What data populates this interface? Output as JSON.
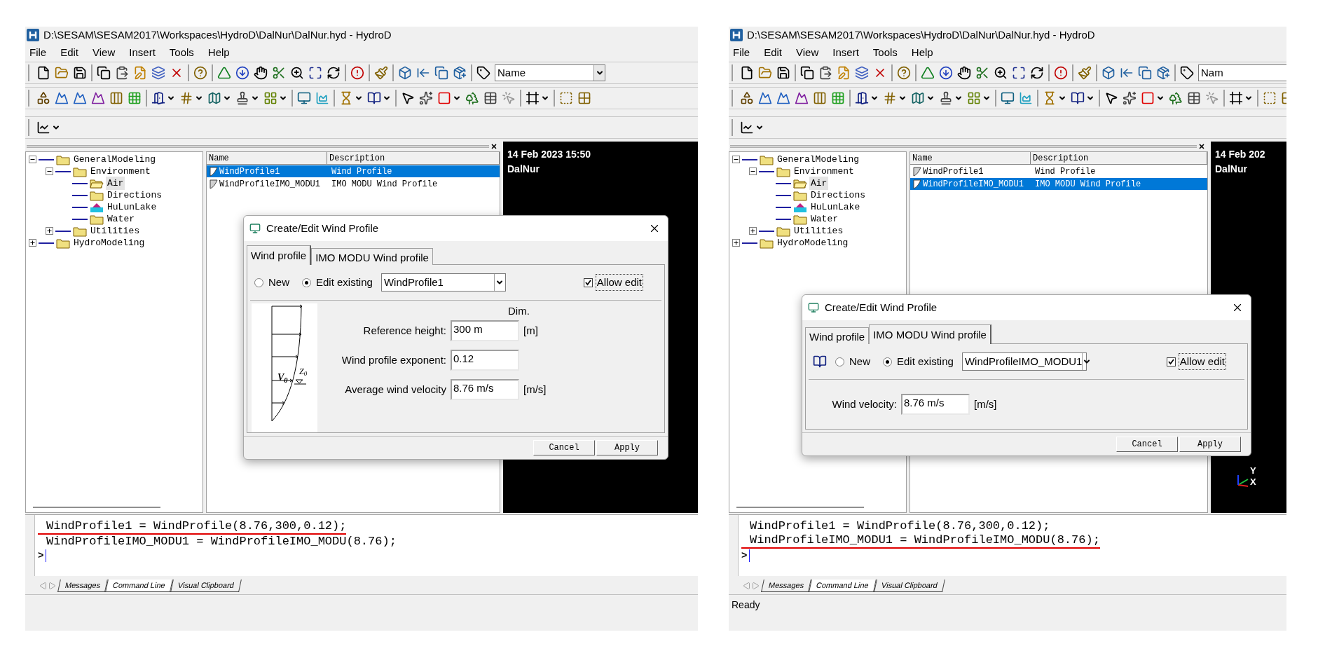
{
  "windows": [
    {
      "title": "D:\\SESAM\\SESAM2017\\Workspaces\\HydroD\\DalNur\\DalNur.hyd - HydroD",
      "menu": [
        "File",
        "Edit",
        "View",
        "Insert",
        "Tools",
        "Help"
      ],
      "toolbar_combo": "Name",
      "tree": [
        {
          "label": "GeneralModeling",
          "kind": "folder",
          "expanded": true,
          "selected": false,
          "children": [
            {
              "label": "Environment",
              "kind": "folder",
              "expanded": true,
              "selected": false,
              "children": [
                {
                  "label": "Air",
                  "kind": "open-folder",
                  "selected": true
                },
                {
                  "label": "Directions",
                  "kind": "folder",
                  "selected": false
                },
                {
                  "label": "HuLunLake",
                  "kind": "lake",
                  "selected": false
                },
                {
                  "label": "Water",
                  "kind": "folder",
                  "selected": false
                }
              ]
            },
            {
              "label": "Utilities",
              "kind": "folder",
              "expanded": false,
              "selected": false
            }
          ]
        },
        {
          "label": "HydroModeling",
          "kind": "folder",
          "expanded": false,
          "selected": false
        }
      ],
      "list": {
        "columns": [
          "Name",
          "Description"
        ],
        "rows": [
          {
            "name": "WindProfile1",
            "description": "Wind Profile",
            "selected": true
          },
          {
            "name": "WindProfileIMO_MODU1",
            "description": "IMO MODU Wind Profile",
            "selected": false
          }
        ]
      },
      "viewport": {
        "date": "14 Feb 2023 15:50",
        "name": "DalNur"
      },
      "dialog": {
        "kind": "wind_profile",
        "title": "Create/Edit Wind Profile",
        "tabs": [
          {
            "label": "Wind profile",
            "selected": true
          },
          {
            "label": "IMO MODU Wind profile",
            "selected": false
          }
        ],
        "modes": [
          {
            "label": "New",
            "selected": false
          },
          {
            "label": "Edit existing",
            "selected": true
          }
        ],
        "dropdown": "WindProfile1",
        "allow_edit": {
          "label": "Allow edit",
          "checked": true
        },
        "diagram_labels": [
          "V$_{0}$",
          "Z$_{0}$"
        ],
        "dim_heading": "Dim.",
        "fields": [
          {
            "label": "Reference height:",
            "value": "300 m",
            "unit": "[m]"
          },
          {
            "label": "Wind profile exponent:",
            "value": "0.12"
          },
          {
            "label": "Average wind velocity",
            "value": "8.76 m/s",
            "unit": "[m/s]"
          }
        ],
        "buttons": [
          "Cancel",
          "Apply"
        ]
      },
      "console": {
        "lines": [
          {
            "text": "WindProfile1 = WindProfile(8.76,300,0.12);",
            "underlined": true
          },
          {
            "text": "WindProfileIMO_MODU1 = WindProfileIMO_MODU(8.76);",
            "underlined": false
          }
        ],
        "prompt": ">",
        "tabs": [
          {
            "label": "Messages",
            "selected": false
          },
          {
            "label": "Command Line",
            "selected": true
          },
          {
            "label": "Visual Clipboard",
            "selected": false
          }
        ]
      }
    },
    {
      "title": "D:\\SESAM\\SESAM2017\\Workspaces\\HydroD\\DalNur\\DalNur.hyd - HydroD",
      "menu": [
        "File",
        "Edit",
        "View",
        "Insert",
        "Tools",
        "Help"
      ],
      "toolbar_combo": "Nam",
      "tree": [
        {
          "label": "GeneralModeling",
          "kind": "folder",
          "expanded": true,
          "selected": false,
          "children": [
            {
              "label": "Environment",
              "kind": "folder",
              "expanded": true,
              "selected": false,
              "children": [
                {
                  "label": "Air",
                  "kind": "open-folder",
                  "selected": true
                },
                {
                  "label": "Directions",
                  "kind": "folder",
                  "selected": false
                },
                {
                  "label": "HuLunLake",
                  "kind": "lake",
                  "selected": false
                },
                {
                  "label": "Water",
                  "kind": "folder",
                  "selected": false
                }
              ]
            },
            {
              "label": "Utilities",
              "kind": "folder",
              "expanded": false,
              "selected": false
            }
          ]
        },
        {
          "label": "HydroModeling",
          "kind": "folder",
          "expanded": false,
          "selected": false
        }
      ],
      "list": {
        "columns": [
          "Name",
          "Description"
        ],
        "rows": [
          {
            "name": "WindProfile1",
            "description": "Wind Profile",
            "selected": false
          },
          {
            "name": "WindProfileIMO_MODU1",
            "description": "IMO MODU Wind Profile",
            "selected": true
          }
        ]
      },
      "viewport": {
        "date": "14 Feb 202",
        "name": "DalNur",
        "axes": {
          "y": "Y",
          "x": "X"
        }
      },
      "dialog": {
        "kind": "imo_modu",
        "title": "Create/Edit Wind Profile",
        "tabs": [
          {
            "label": "Wind profile",
            "selected": false
          },
          {
            "label": "IMO MODU Wind profile",
            "selected": true
          }
        ],
        "modes": [
          {
            "label": "New",
            "selected": false
          },
          {
            "label": "Edit existing",
            "selected": true
          }
        ],
        "dropdown": "WindProfileIMO_MODU1",
        "allow_edit": {
          "label": "Allow edit",
          "checked": true
        },
        "fields": [
          {
            "label": "Wind velocity:",
            "value": "8.76 m/s",
            "unit": "[m/s]"
          }
        ],
        "buttons": [
          "Cancel",
          "Apply"
        ]
      },
      "console": {
        "lines": [
          {
            "text": "WindProfile1 = WindProfile(8.76,300,0.12);",
            "underlined": false
          },
          {
            "text": "WindProfileIMO_MODU1 = WindProfileIMO_MODU(8.76);",
            "underlined": true
          }
        ],
        "prompt": ">",
        "tabs": [
          {
            "label": "Messages",
            "selected": false
          },
          {
            "label": "Command Line",
            "selected": true
          },
          {
            "label": "Visual Clipboard",
            "selected": false
          }
        ]
      },
      "status": "Ready"
    }
  ]
}
